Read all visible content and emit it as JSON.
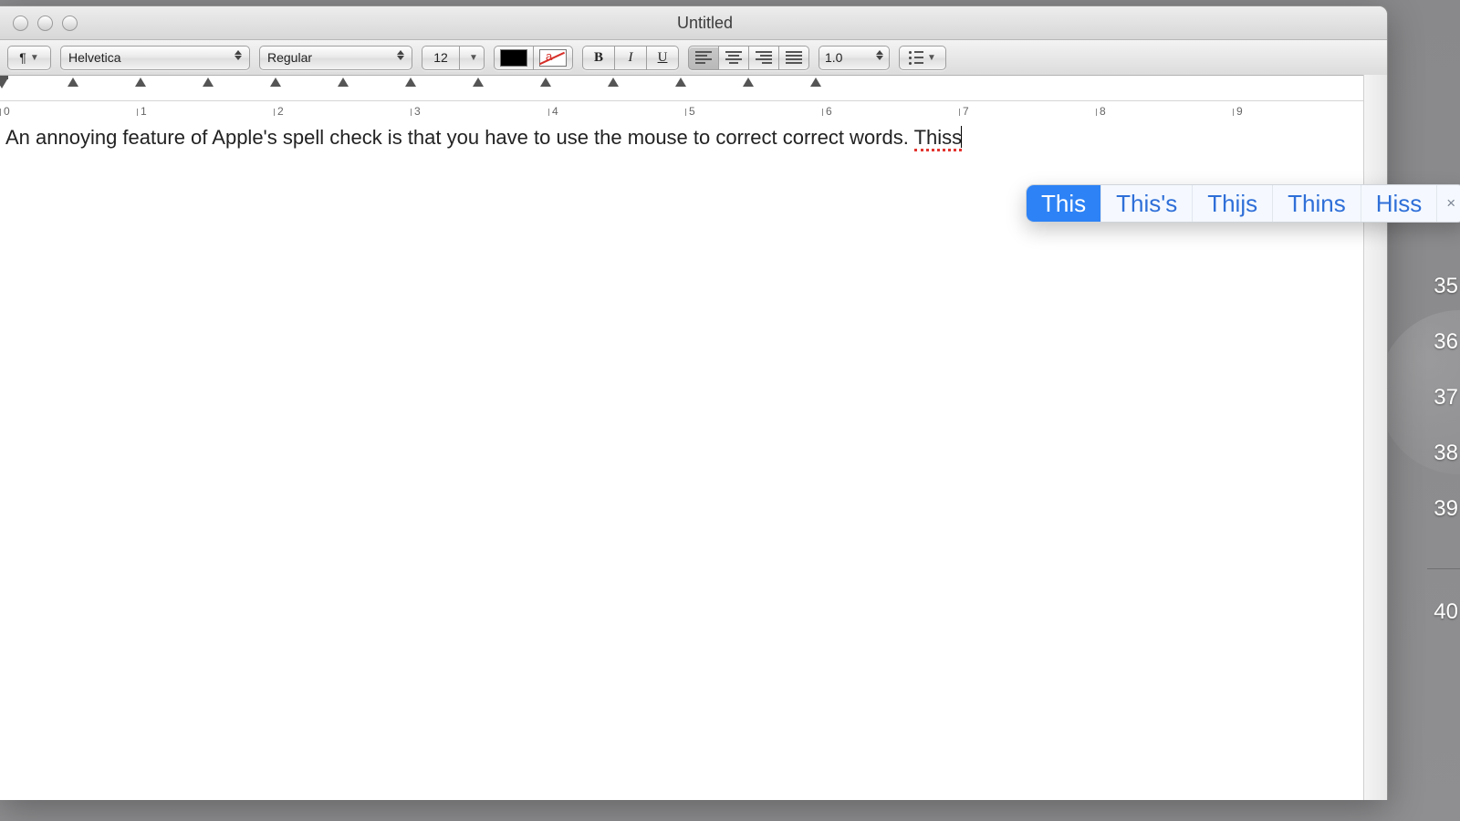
{
  "window": {
    "title": "Untitled"
  },
  "toolbar": {
    "paragraph_symbol": "¶",
    "font": "Helvetica",
    "weight": "Regular",
    "size": "12",
    "bold": "B",
    "italic": "I",
    "underline": "U",
    "spacing": "1.0"
  },
  "ruler": {
    "numbers": [
      "0",
      "1",
      "2",
      "3",
      "4",
      "5",
      "6",
      "7",
      "8",
      "9"
    ],
    "tabstop_count": 12
  },
  "document": {
    "text_before": "An annoying feature of Apple's spell check is that you have to use the mouse to correct correct words. ",
    "misspelled": "Thiss"
  },
  "suggestions": {
    "items": [
      "This",
      "This's",
      "Thijs",
      "Thins",
      "Hiss"
    ],
    "selected_index": 0,
    "close": "×"
  },
  "side_hints": [
    "35",
    "36",
    "37",
    "38",
    "39",
    "40"
  ]
}
